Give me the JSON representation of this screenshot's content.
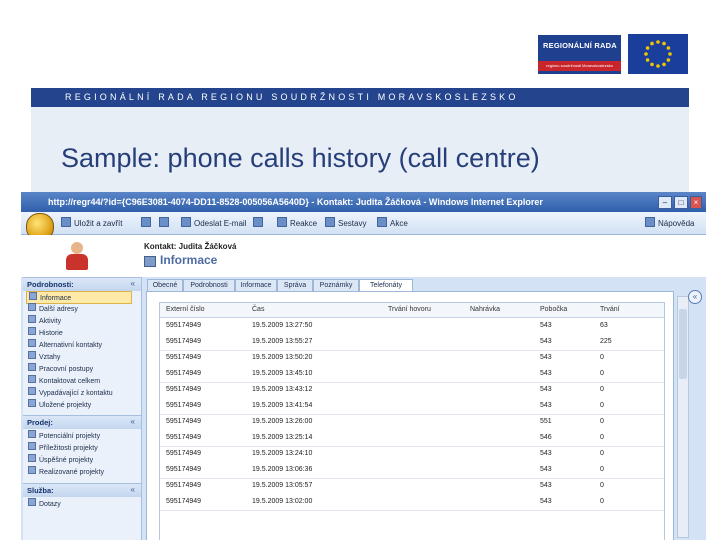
{
  "logo": {
    "rr_title": "REGIONÁLNÍ RADA",
    "rr_sub": "regionu soudržnosti Moravskoslezsko",
    "eu_colors": {
      "blue": "#1a3e9c",
      "star": "#f2c500"
    }
  },
  "band_text": "REGIONÁLNÍ RADA REGIONU SOUDRŽNOSTI MORAVSKOSLEZSKO",
  "slide_title": "Sample: phone calls history (call centre)",
  "window": {
    "title": "http://regr44/?id={C96E3081-4074-DD11-8528-005056A5640D} - Kontakt: Judita Žáčková - Windows Internet Explorer"
  },
  "toolbar": {
    "save_close": "Uložit a zavřít",
    "send_email": "Odeslat E-mail",
    "reactions": "Reakce",
    "reports": "Sestavy",
    "actions": "Akce",
    "help": "Nápověda"
  },
  "header": {
    "contact": "Kontakt: Judita Žáčková",
    "form_title": "Informace"
  },
  "nav": {
    "sections": [
      {
        "label": "Podrobnosti:",
        "items": [
          "Informace",
          "Další adresy",
          "Aktivity",
          "Historie",
          "Alternativní kontakty",
          "Vztahy",
          "Pracovní postupy",
          "Kontaktovat celkem",
          "Vypadávající z kontaktu",
          "Uložené projekty"
        ]
      },
      {
        "label": "Prodej:",
        "items": [
          "Potenciální projekty",
          "Příležitosti projekty",
          "Úspěšné projekty",
          "Realizované projekty"
        ]
      },
      {
        "label": "Služba:",
        "items": [
          "Dotazy"
        ]
      }
    ]
  },
  "tabs": [
    "Obecné",
    "Podrobnosti",
    "Informace",
    "Správa",
    "Poznámky",
    "Telefonáty"
  ],
  "table": {
    "columns": [
      "Externí číslo",
      "Čas",
      "Trvání hovoru",
      "Nahrávka",
      "Pobočka",
      "Trvání"
    ],
    "rows": [
      [
        "595174949",
        "19.5.2009 13:27:50",
        "",
        "",
        "543",
        "63"
      ],
      [
        "595174949",
        "19.5.2009 13:55:27",
        "",
        "",
        "543",
        "225"
      ],
      [
        "595174949",
        "19.5.2009 13:50:20",
        "",
        "",
        "543",
        "0"
      ],
      [
        "595174949",
        "19.5.2009 13:45:10",
        "",
        "",
        "543",
        "0"
      ],
      [
        "595174949",
        "19.5.2009 13:43:12",
        "",
        "",
        "543",
        "0"
      ],
      [
        "595174949",
        "19.5.2009 13:41:54",
        "",
        "",
        "543",
        "0"
      ],
      [
        "595174949",
        "19.5.2009 13:26:00",
        "",
        "",
        "551",
        "0"
      ],
      [
        "595174949",
        "19.5.2009 13:25:14",
        "",
        "",
        "546",
        "0"
      ],
      [
        "595174949",
        "19.5.2009 13:24:10",
        "",
        "",
        "543",
        "0"
      ],
      [
        "595174949",
        "19.5.2009 13:06:36",
        "",
        "",
        "543",
        "0"
      ],
      [
        "595174949",
        "19.5.2009 13:05:57",
        "",
        "",
        "543",
        "0"
      ],
      [
        "595174949",
        "19.5.2009 13:02:00",
        "",
        "",
        "543",
        "0"
      ]
    ]
  }
}
